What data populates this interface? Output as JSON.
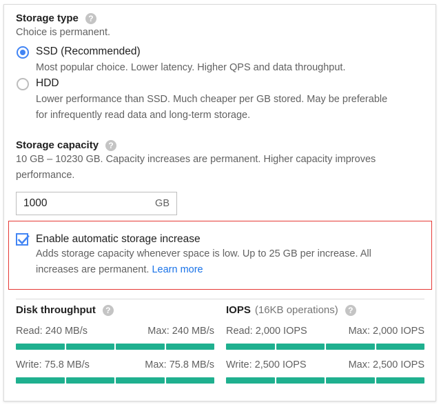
{
  "storage_type": {
    "title": "Storage type",
    "subtitle": "Choice is permanent.",
    "options": [
      {
        "label": "SSD (Recommended)",
        "description": "Most popular choice. Lower latency. Higher QPS and data throughput.",
        "selected": true
      },
      {
        "label": "HDD",
        "description_line1": "Lower performance than SSD. Much cheaper per GB stored. May be preferable",
        "description_line2": "for infrequently read data and long-term storage.",
        "selected": false
      }
    ]
  },
  "storage_capacity": {
    "title": "Storage capacity",
    "description_line1": "10 GB – 10230 GB. Capacity increases are permanent. Higher capacity improves",
    "description_line2": "performance.",
    "value": "1000",
    "unit": "GB"
  },
  "auto_increase": {
    "label": "Enable automatic storage increase",
    "checked": true,
    "description_line1": "Adds storage capacity whenever space is low. Up to 25 GB per increase. All",
    "description_line2": "increases are permanent.",
    "link_text": "Learn more"
  },
  "disk_throughput": {
    "title": "Disk throughput",
    "read_label": "Read: 240 MB/s",
    "read_max": "Max: 240 MB/s",
    "read_fraction": 1.0,
    "write_label": "Write: 75.8 MB/s",
    "write_max": "Max: 75.8 MB/s",
    "write_fraction": 1.0
  },
  "iops": {
    "title": "IOPS",
    "title_extra": "(16KB operations)",
    "read_label": "Read: 2,000 IOPS",
    "read_max": "Max: 2,000 IOPS",
    "read_fraction": 1.0,
    "write_label": "Write: 2,500 IOPS",
    "write_max": "Max: 2,500 IOPS",
    "write_fraction": 1.0
  },
  "colors": {
    "accent": "#4285f4",
    "bar": "#1fb08f",
    "highlight_border": "#e53935",
    "link": "#1a73e8"
  },
  "icons": {
    "help": "help-circle-icon",
    "check": "checkmark-icon"
  }
}
